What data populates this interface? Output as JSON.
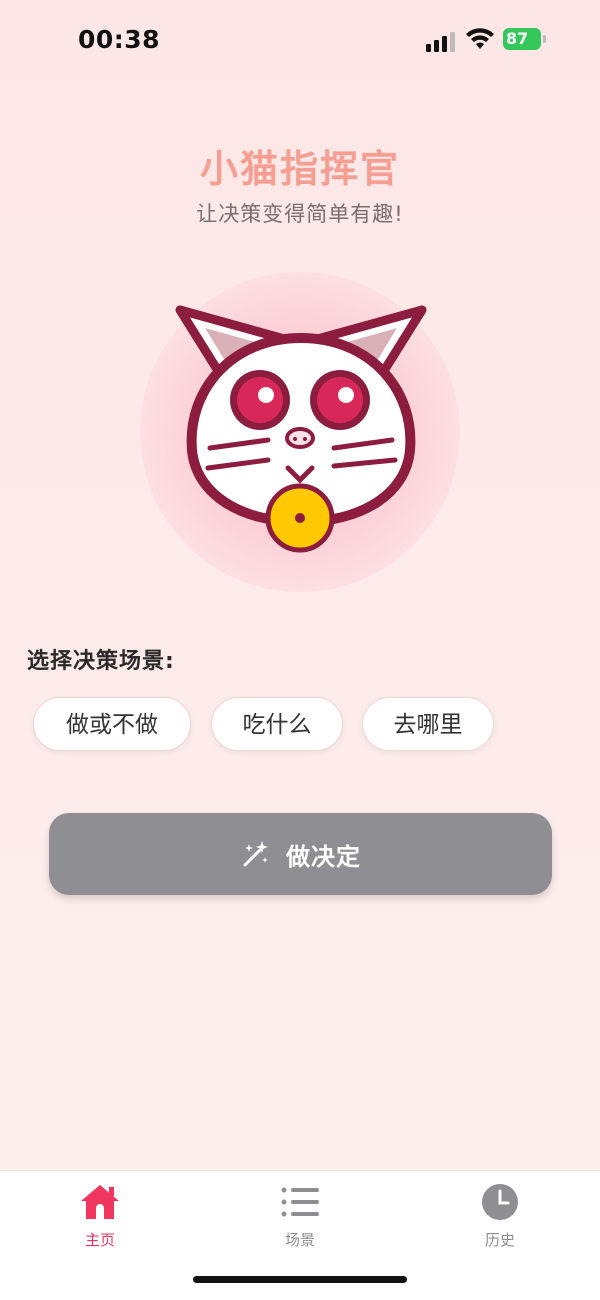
{
  "status_bar": {
    "time": "00:38",
    "battery_level": "87",
    "battery_color": "#34c759"
  },
  "header": {
    "title": "小猫指挥官",
    "subtitle": "让决策变得简单有趣!"
  },
  "mascot": {
    "icon": "cat-mascot-icon",
    "colors": {
      "outline": "#8c1d3f",
      "eyes": "#d8285a",
      "coin": "#ffc800"
    }
  },
  "scenes": {
    "heading": "选择决策场景:",
    "options": [
      "做或不做",
      "吃什么",
      "去哪里"
    ]
  },
  "decide_button": {
    "label": "做决定",
    "icon": "magic-wand-icon",
    "color": "#8e8e93"
  },
  "tab_bar": {
    "accent_color": "#f0365f",
    "tabs": [
      {
        "label": "主页",
        "icon": "home-icon",
        "active": true
      },
      {
        "label": "场景",
        "icon": "list-icon",
        "active": false
      },
      {
        "label": "历史",
        "icon": "clock-icon",
        "active": false
      }
    ]
  }
}
